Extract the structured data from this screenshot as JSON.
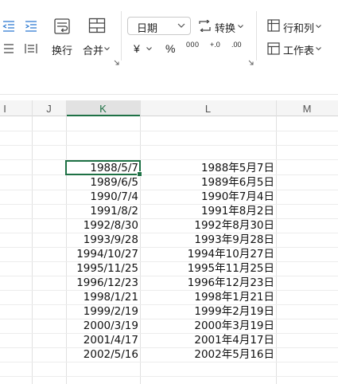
{
  "ribbon": {
    "wrap_text_label": "换行",
    "merge_label": "合并",
    "number_format_value": "日期",
    "convert_label": "转换",
    "rows_cols_label": "行和列",
    "worksheet_label": "工作表",
    "currency_symbol": "¥",
    "percent_symbol": "%",
    "thousands_symbol": "000",
    "increase_decimal_symbol": "+.0",
    "decrease_decimal_symbol": ".00"
  },
  "grid": {
    "columns": [
      "I",
      "J",
      "K",
      "L",
      "M"
    ],
    "rows": [
      {
        "k": "1988/5/7",
        "l": "1988年5月7日"
      },
      {
        "k": "1989/6/5",
        "l": "1989年6月5日"
      },
      {
        "k": "1990/7/4",
        "l": "1990年7月4日"
      },
      {
        "k": "1991/8/2",
        "l": "1991年8月2日"
      },
      {
        "k": "1992/8/30",
        "l": "1992年8月30日"
      },
      {
        "k": "1993/9/28",
        "l": "1993年9月28日"
      },
      {
        "k": "1994/10/27",
        "l": "1994年10月27日"
      },
      {
        "k": "1995/11/25",
        "l": "1995年11月25日"
      },
      {
        "k": "1996/12/23",
        "l": "1996年12月23日"
      },
      {
        "k": "1998/1/21",
        "l": "1998年1月21日"
      },
      {
        "k": "1999/2/19",
        "l": "1999年2月19日"
      },
      {
        "k": "2000/3/19",
        "l": "2000年3月19日"
      },
      {
        "k": "2001/4/17",
        "l": "2001年4月17日"
      },
      {
        "k": "2002/5/16",
        "l": "2002年5月16日"
      }
    ]
  },
  "colors": {
    "accent": "#1e7145",
    "ribbon_icon": "#444444",
    "indent_icon": "#2b78d0"
  }
}
